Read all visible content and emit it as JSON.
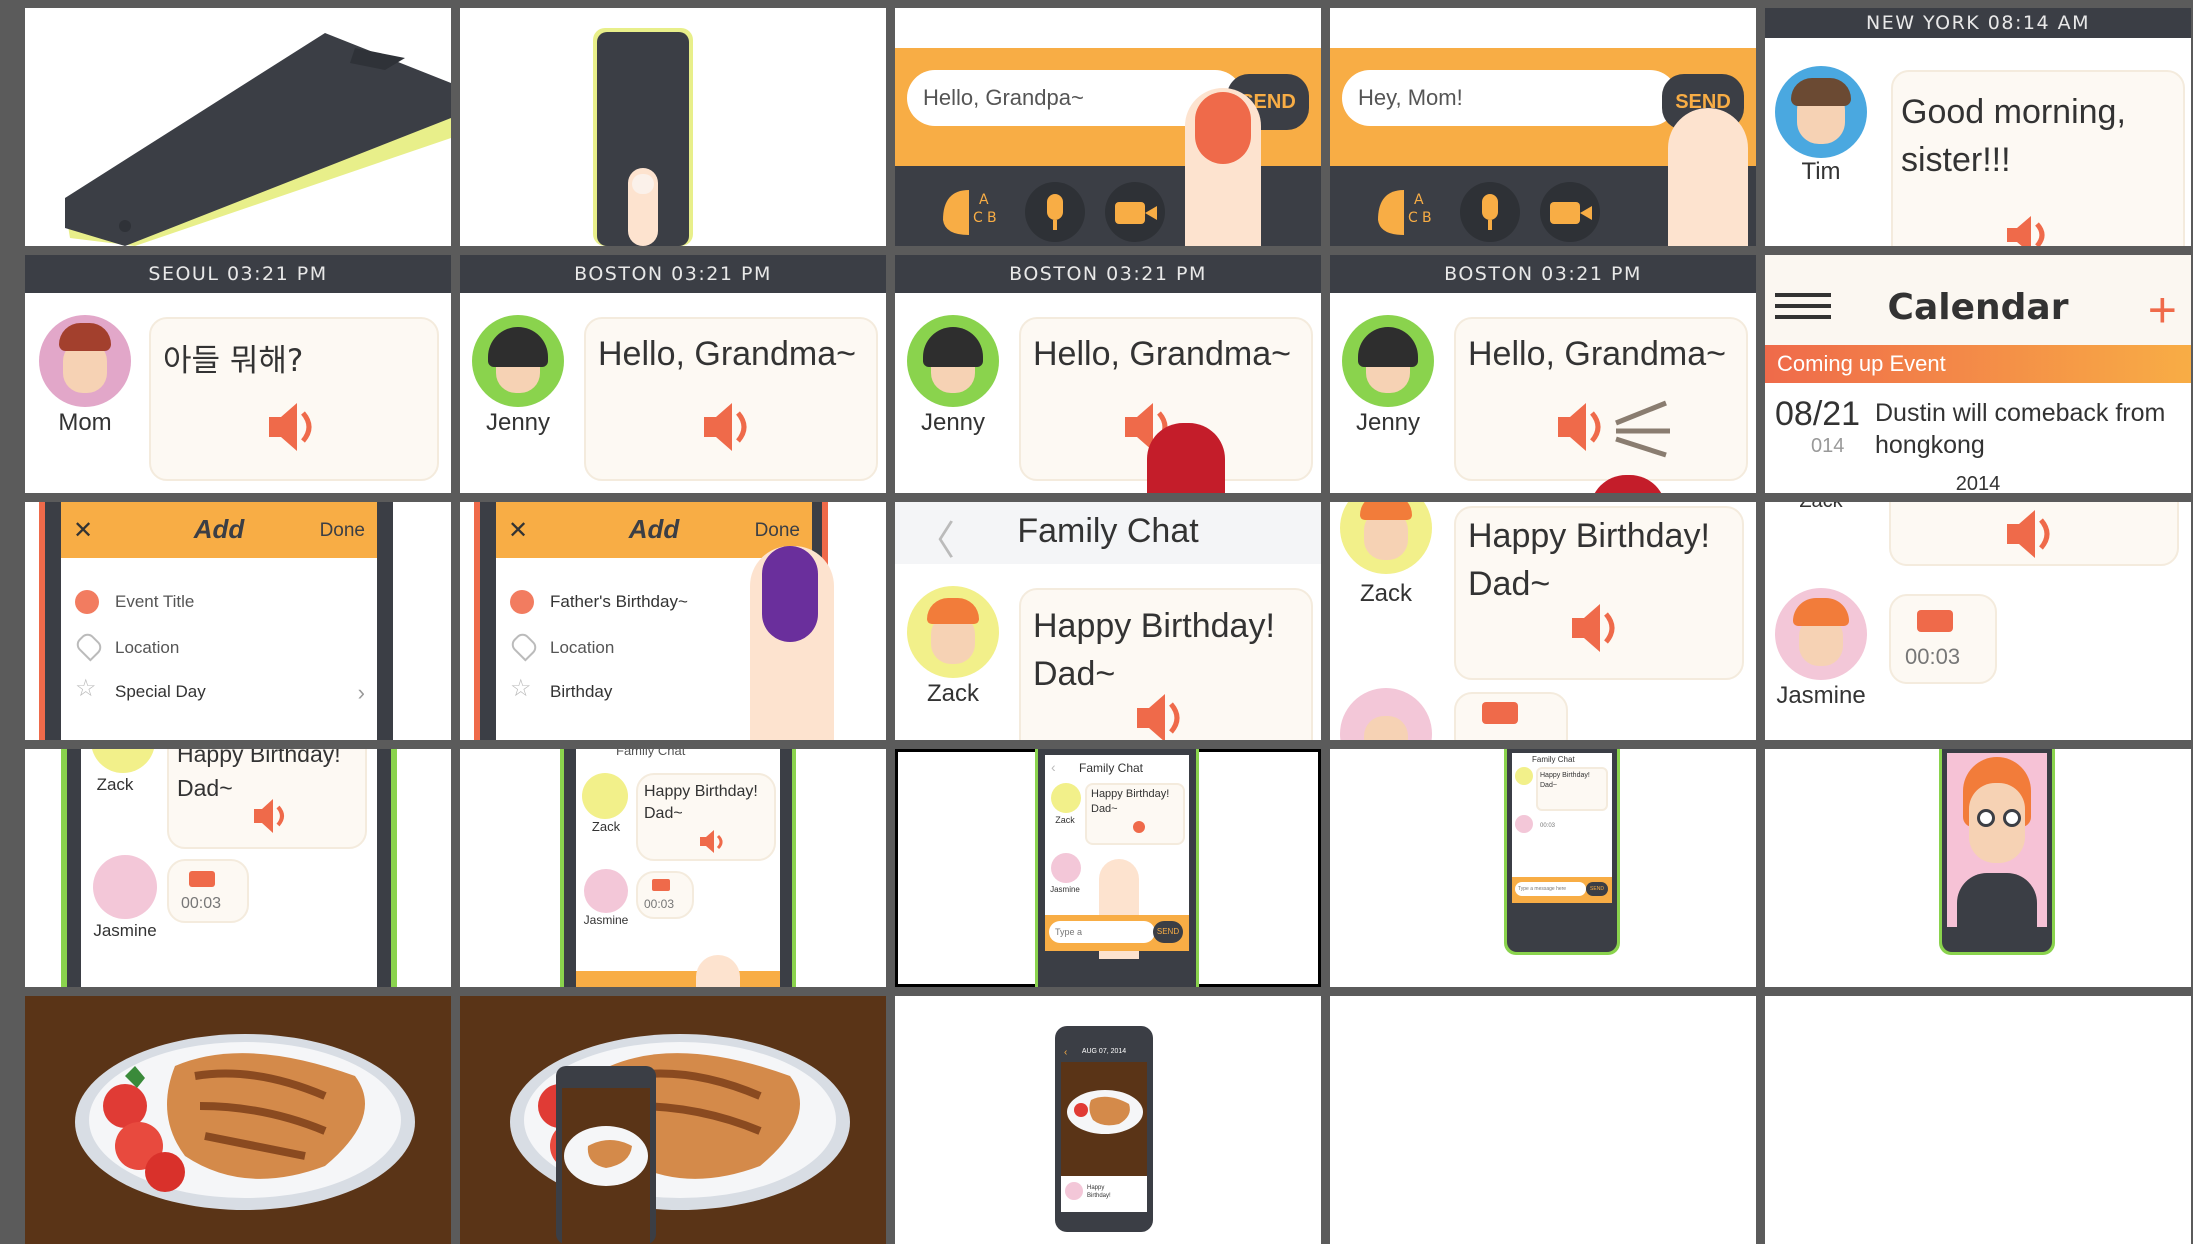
{
  "colors": {
    "accent": "#f8ad45",
    "dark": "#3b3e45",
    "speaker": "#ef6a4a",
    "coral": "#f27c60",
    "lime": "#e8ef8a",
    "green": "#8ad34d"
  },
  "r1": {
    "c3": {
      "input": "Hello, Grandpa~",
      "send": "SEND",
      "abc_a": "A",
      "abc_b": "B",
      "abc_c": "C"
    },
    "c4": {
      "input": "Hey, Mom!",
      "send": "SEND",
      "abc_a": "A",
      "abc_b": "B",
      "abc_c": "C"
    },
    "c5": {
      "header": "NEW YORK 08:14 AM",
      "name": "Tim",
      "msg1": "Good morning,",
      "msg2": "sister!!!"
    }
  },
  "r2": {
    "c1": {
      "header": "SEOUL 03:21 PM",
      "name": "Mom",
      "msg": "아들 뭐해?"
    },
    "c2": {
      "header": "BOSTON 03:21 PM",
      "name": "Jenny",
      "msg": "Hello, Grandma~"
    },
    "c3": {
      "header": "BOSTON 03:21 PM",
      "name": "Jenny",
      "msg": "Hello, Grandma~"
    },
    "c4": {
      "header": "BOSTON 03:21 PM",
      "name": "Jenny",
      "msg": "Hello, Grandma~"
    },
    "c5": {
      "title": "Calendar",
      "plus": "+",
      "upcoming": "Coming up Event",
      "date": "08/21",
      "year_fragment": "014",
      "event1": "Dustin will comeback from",
      "event2": "hongkong",
      "year": "2014"
    }
  },
  "r3": {
    "c1": {
      "close": "✕",
      "title": "Add",
      "done": "Done",
      "field1": "Event Title",
      "field2": "Location",
      "field3": "Special Day"
    },
    "c2": {
      "close": "✕",
      "title": "Add",
      "done": "Done",
      "field1": "Father's Birthday~",
      "field2": "Location",
      "field3": "Birthday"
    },
    "c3": {
      "back": "〈",
      "title": "Family Chat",
      "name": "Zack",
      "msg1": "Happy Birthday!",
      "msg2": "Dad~"
    },
    "c4": {
      "name": "Zack",
      "msg1": "Happy Birthday!",
      "msg2": "Dad~"
    },
    "c5": {
      "name_cut": "Zack",
      "name": "Jasmine",
      "time": "00:03"
    }
  },
  "r4": {
    "c1": {
      "name1": "Zack",
      "msg1": "Happy Birthday!",
      "msg2": "Dad~",
      "name2": "Jasmine",
      "time": "00:03"
    },
    "c2": {
      "header_cut": "Family Chat",
      "name1": "Zack",
      "msg1": "Happy Birthday!",
      "msg2": "Dad~",
      "name2": "Jasmine",
      "time": "00:03"
    },
    "c3": {
      "title": "Family Chat",
      "name1": "Zack",
      "msg1": "Happy Birthday!",
      "msg2": "Dad~",
      "name2": "Jasmine",
      "input": "Type a",
      "send": "SEND"
    },
    "c4": {
      "title": "Family Chat",
      "msg1": "Happy Birthday!",
      "msg2": "Dad~",
      "time": "00:03",
      "input": "Type a message here",
      "send": "SEND"
    }
  },
  "r5": {
    "c3": {
      "date": "AUG 07, 2014",
      "msg1": "Happy",
      "msg2": "Birthday!"
    }
  }
}
